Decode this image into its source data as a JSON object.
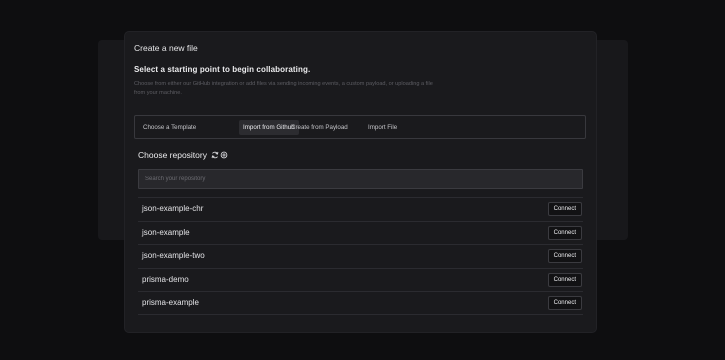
{
  "dialog": {
    "title": "Create a new file",
    "subtitle": "Select a starting point to begin collaborating.",
    "description": "Choose from either our GitHub integration or add files via sending incoming events, a custom payload, or uploading a file from your machine."
  },
  "tabs": [
    {
      "label": "Choose a Template",
      "active": false
    },
    {
      "label": "Import from Github",
      "active": true
    },
    {
      "label": "Create from Payload",
      "active": false
    },
    {
      "label": "Import File",
      "active": false
    }
  ],
  "repository": {
    "heading": "Choose repository",
    "icons": [
      "refresh-icon",
      "settings-icon"
    ],
    "search_placeholder": "Search your repository",
    "connect_label": "Connect",
    "items": [
      {
        "name": "json-example-chr",
        "action": "Connect"
      },
      {
        "name": "json-example",
        "action": "Connect"
      },
      {
        "name": "json-example-two",
        "action": "Connect"
      },
      {
        "name": "prisma-demo",
        "action": "Connect"
      },
      {
        "name": "prisma-example",
        "action": "Connect"
      }
    ]
  }
}
